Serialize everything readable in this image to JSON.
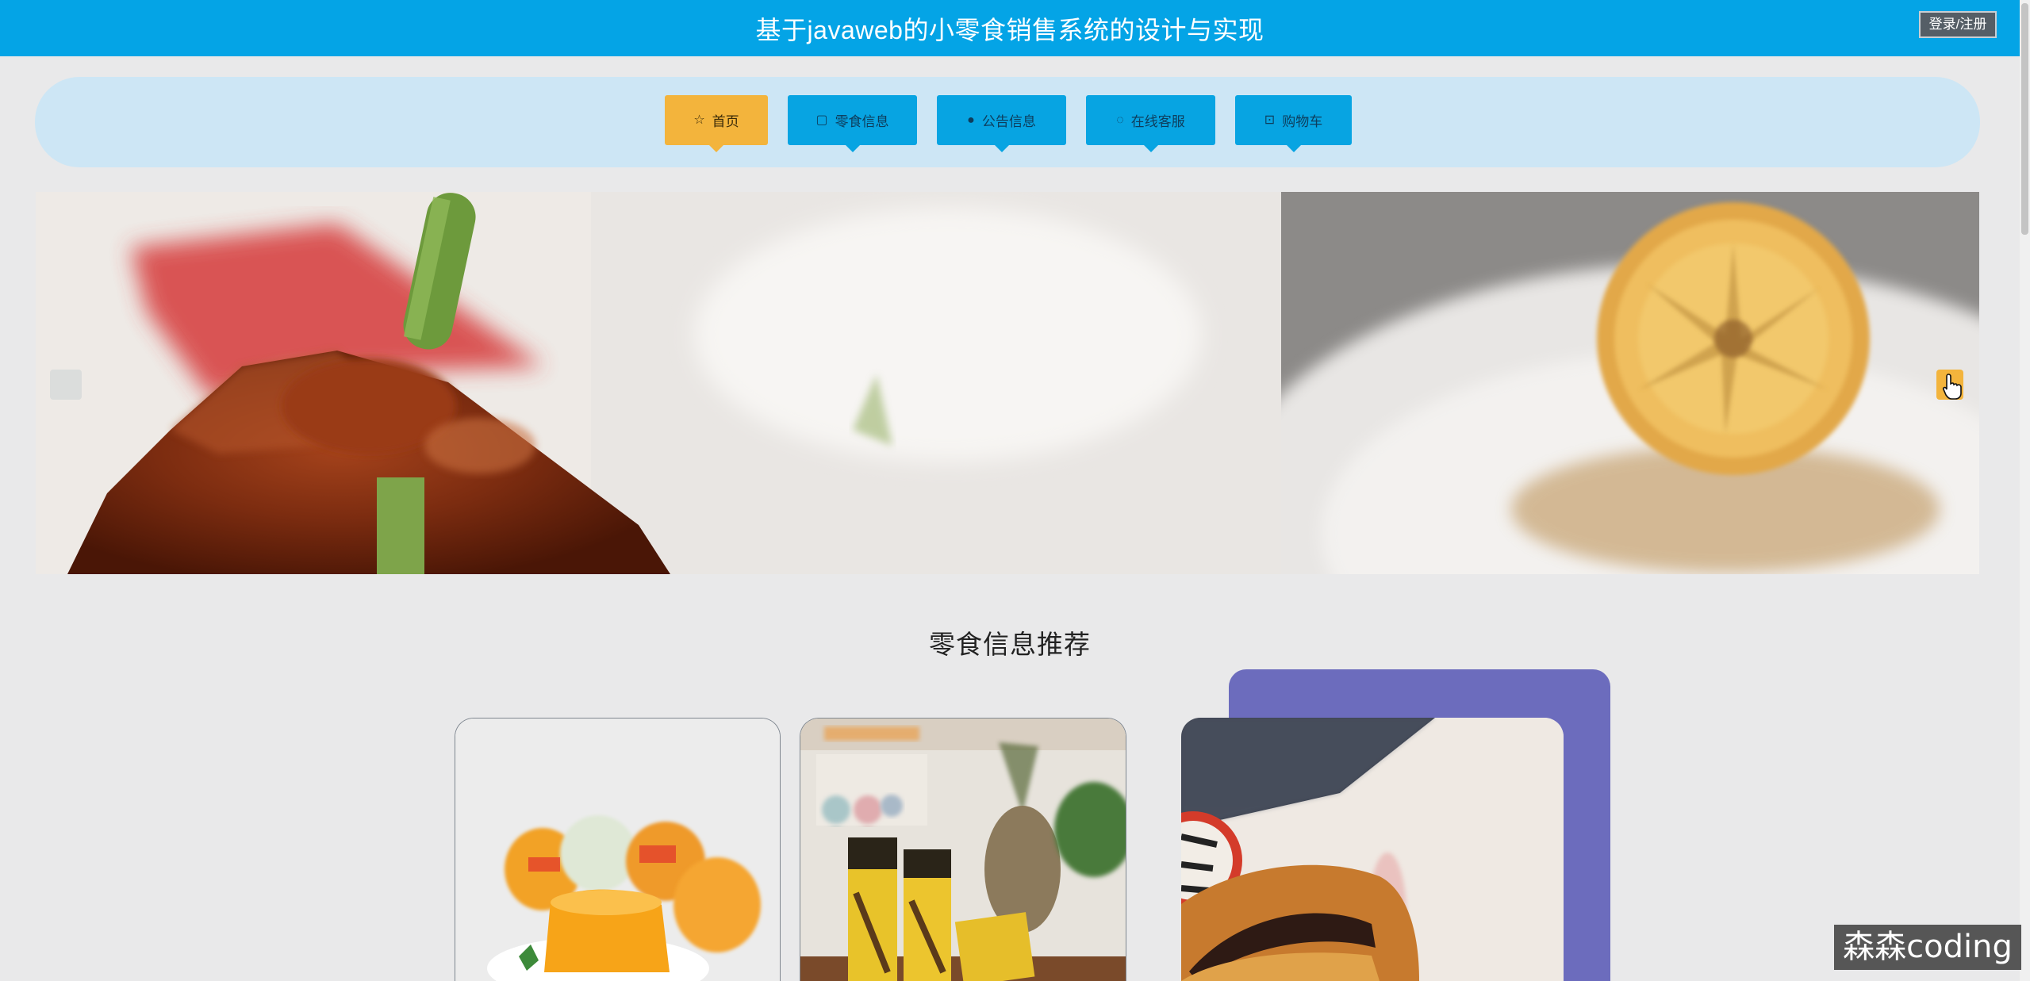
{
  "header": {
    "title": "基于javaweb的小零食销售系统的设计与实现",
    "login_label": "登录/注册"
  },
  "nav": {
    "items": [
      {
        "label": "首页",
        "icon": "star-icon",
        "active": true
      },
      {
        "label": "零食信息",
        "icon": "bag-icon",
        "active": false
      },
      {
        "label": "公告信息",
        "icon": "info-circle-icon",
        "active": false
      },
      {
        "label": "在线客服",
        "icon": "headset-icon",
        "active": false
      },
      {
        "label": "购物车",
        "icon": "cart-icon",
        "active": false
      }
    ]
  },
  "banner": {
    "slides": [
      {
        "subject": "glazed roast meat with asparagus"
      },
      {
        "subject": "candied lemon slice"
      }
    ]
  },
  "recommend": {
    "title": "零食信息推荐",
    "items": [
      {
        "subject": "fruit jelly cups"
      },
      {
        "subject": "Pocky chocolate sticks"
      },
      {
        "subject": "red bean dorayaki pancake"
      }
    ]
  },
  "watermark": "森森coding",
  "colors": {
    "header_bg": "#04a4e6",
    "nav_band": "#cde6f5",
    "nav_active": "#f3b43c",
    "nav_button": "#07a4e2",
    "card_accent": "#6c6cbd",
    "page_bg": "#e9e9ea"
  }
}
